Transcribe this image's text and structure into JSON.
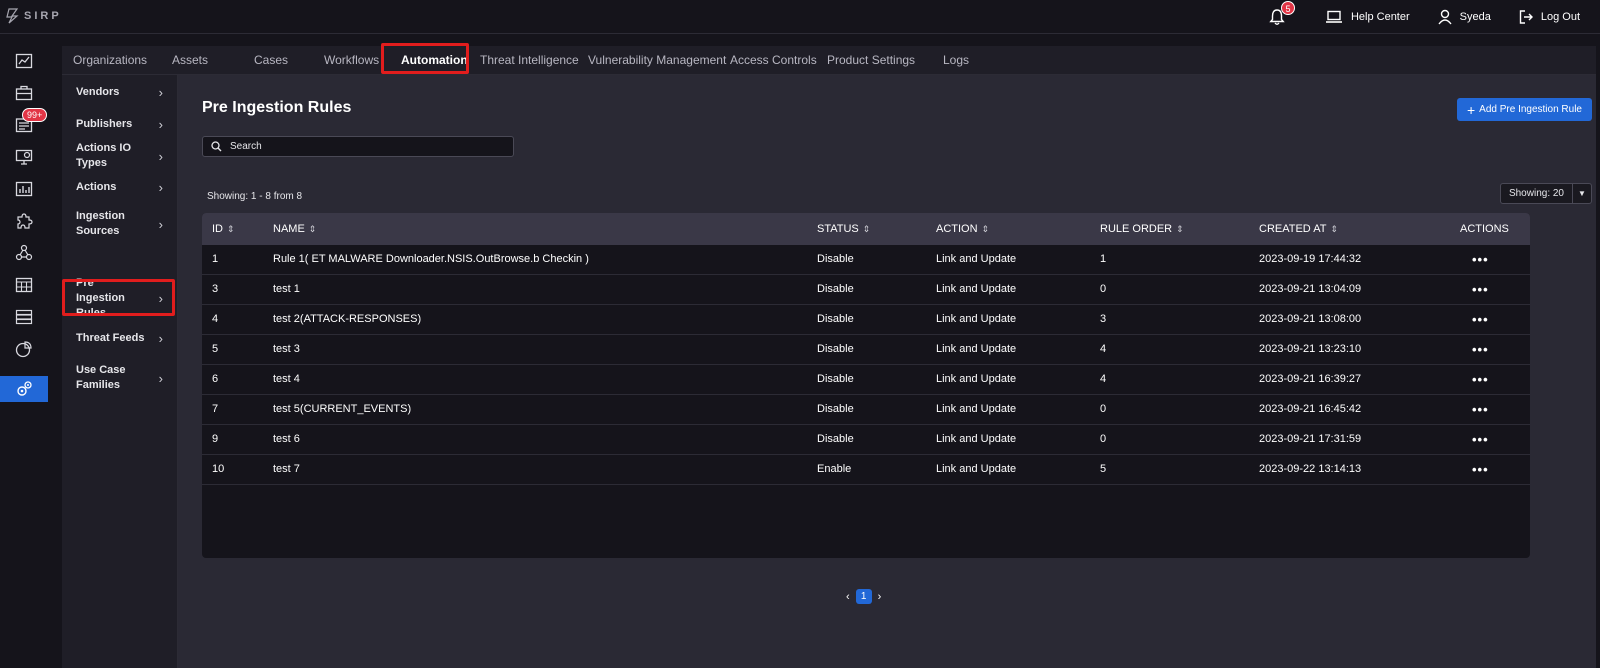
{
  "app": {
    "logo_text": "SIRP"
  },
  "topbar": {
    "notifications_count": "5",
    "help_label": "Help Center",
    "user_name": "Syeda",
    "logout_label": "Log Out"
  },
  "rail": {
    "items": [
      {
        "icon": "dashboard-icon"
      },
      {
        "icon": "briefcase-icon"
      },
      {
        "icon": "cases-icon",
        "badge": "99+"
      },
      {
        "icon": "monitor-alert-icon"
      },
      {
        "icon": "chart-icon"
      },
      {
        "icon": "puzzle-icon"
      },
      {
        "icon": "network-icon"
      },
      {
        "icon": "calendar-grid-icon"
      },
      {
        "icon": "server-icon"
      },
      {
        "icon": "pie-chart-icon"
      },
      {
        "icon": "gears-icon"
      }
    ]
  },
  "tabs": [
    {
      "label": "Organizations"
    },
    {
      "label": "Assets"
    },
    {
      "label": "Cases"
    },
    {
      "label": "Workflows"
    },
    {
      "label": "Automation"
    },
    {
      "label": "Threat Intelligence"
    },
    {
      "label": "Vulnerability Management"
    },
    {
      "label": "Access Controls"
    },
    {
      "label": "Product Settings"
    },
    {
      "label": "Logs"
    }
  ],
  "subnav": [
    {
      "label": "Vendors"
    },
    {
      "label": "Publishers"
    },
    {
      "label": "Actions IO Types"
    },
    {
      "label": "Actions"
    },
    {
      "label": "Ingestion Sources"
    },
    {
      "label": "Pre Ingestion Rules"
    },
    {
      "label": "Threat Feeds"
    },
    {
      "label": "Use Case Families"
    }
  ],
  "main": {
    "title": "Pre Ingestion Rules",
    "add_button": "Add Pre Ingestion Rule",
    "search_placeholder": "Search",
    "showing": "Showing: 1 - 8 from 8",
    "per_page": "Showing: 20"
  },
  "table": {
    "columns": [
      "ID",
      "NAME",
      "STATUS",
      "ACTION",
      "RULE ORDER",
      "CREATED AT",
      "ACTIONS"
    ],
    "rows": [
      {
        "id": "1",
        "name": "Rule 1( ET MALWARE Downloader.NSIS.OutBrowse.b Checkin )",
        "status": "Disable",
        "action": "Link and Update",
        "order": "1",
        "created": "2023-09-19 17:44:32"
      },
      {
        "id": "3",
        "name": "test 1",
        "status": "Disable",
        "action": "Link and Update",
        "order": "0",
        "created": "2023-09-21 13:04:09"
      },
      {
        "id": "4",
        "name": "test 2(ATTACK-RESPONSES)",
        "status": "Disable",
        "action": "Link and Update",
        "order": "3",
        "created": "2023-09-21 13:08:00"
      },
      {
        "id": "5",
        "name": "test 3",
        "status": "Disable",
        "action": "Link and Update",
        "order": "4",
        "created": "2023-09-21 13:23:10"
      },
      {
        "id": "6",
        "name": "test 4",
        "status": "Disable",
        "action": "Link and Update",
        "order": "4",
        "created": "2023-09-21 16:39:27"
      },
      {
        "id": "7",
        "name": "test 5(CURRENT_EVENTS)",
        "status": "Disable",
        "action": "Link and Update",
        "order": "0",
        "created": "2023-09-21 16:45:42"
      },
      {
        "id": "9",
        "name": "test 6",
        "status": "Disable",
        "action": "Link and Update",
        "order": "0",
        "created": "2023-09-21 17:31:59"
      },
      {
        "id": "10",
        "name": "test 7",
        "status": "Enable",
        "action": "Link and Update",
        "order": "5",
        "created": "2023-09-22 13:14:13"
      }
    ],
    "row_menu": "•••"
  },
  "pagination": {
    "current": "1",
    "prev": "‹",
    "next": "›"
  }
}
